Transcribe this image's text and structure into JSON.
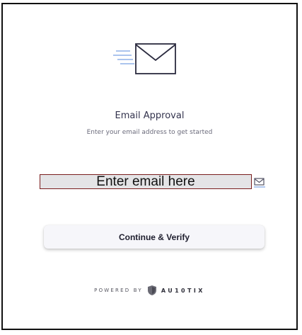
{
  "header": {
    "title": "Email Approval",
    "subtitle": "Enter your email address to get started"
  },
  "email_field": {
    "placeholder": "Enter email here",
    "value": ""
  },
  "continue_button": {
    "label": "Continue & Verify"
  },
  "footer": {
    "powered_by": "POWERED BY",
    "brand": "AU10TIX"
  },
  "icons": {
    "hero": "envelope-icon",
    "field": "mail-icon",
    "brand_logo": "shield-icon"
  },
  "colors": {
    "accent": "#8fb1e8",
    "text_primary": "#33334d",
    "input_border": "#7a1d1d",
    "input_bg": "#e4e4e6"
  }
}
